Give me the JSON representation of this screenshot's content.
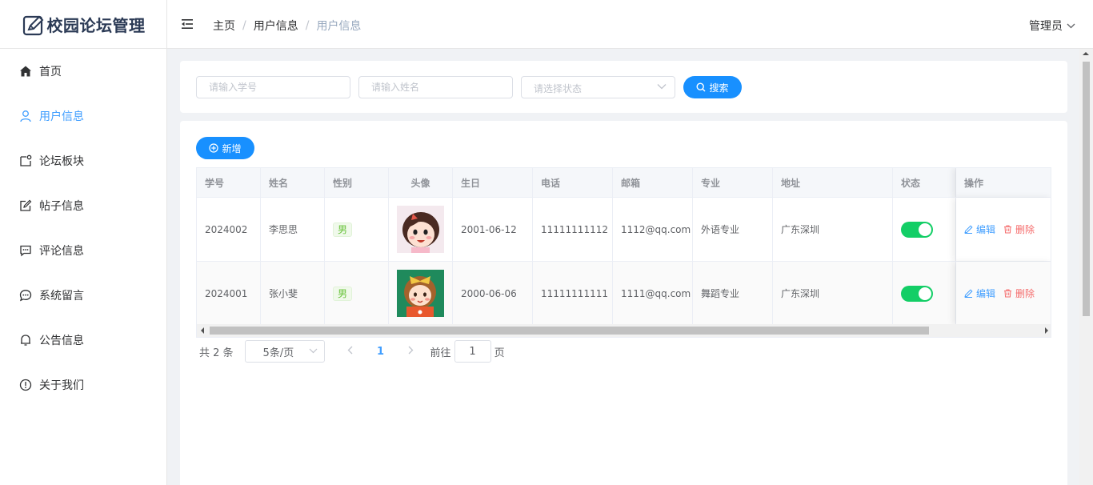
{
  "app": {
    "title": "校园论坛管理"
  },
  "breadcrumb": [
    "主页",
    "用户信息",
    "用户信息"
  ],
  "user_menu": {
    "label": "管理员"
  },
  "sidebar": {
    "items": [
      {
        "label": "首页",
        "icon": "home-icon",
        "active": false
      },
      {
        "label": "用户信息",
        "icon": "user-icon",
        "active": true
      },
      {
        "label": "论坛板块",
        "icon": "board-icon",
        "active": false
      },
      {
        "label": "帖子信息",
        "icon": "edit-icon",
        "active": false
      },
      {
        "label": "评论信息",
        "icon": "comment-icon",
        "active": false
      },
      {
        "label": "系统留言",
        "icon": "chat-icon",
        "active": false
      },
      {
        "label": "公告信息",
        "icon": "bell-icon",
        "active": false
      },
      {
        "label": "关于我们",
        "icon": "info-icon",
        "active": false
      }
    ]
  },
  "search": {
    "id_placeholder": "请输入学号",
    "name_placeholder": "请输入姓名",
    "status_placeholder": "请选择状态",
    "search_label": "搜索"
  },
  "toolbar": {
    "add_label": "新增"
  },
  "table": {
    "headers": {
      "id": "学号",
      "name": "姓名",
      "gender": "性别",
      "avatar": "头像",
      "birth": "生日",
      "phone": "电话",
      "email": "邮箱",
      "major": "专业",
      "address": "地址",
      "status": "状态",
      "ops": "操作"
    },
    "rows": [
      {
        "id": "2024002",
        "name": "李思思",
        "gender": "男",
        "birth": "2001-06-12",
        "phone": "11111111112",
        "email": "1112@qq.com",
        "major": "外语专业",
        "address": "广东深圳",
        "status_on": true,
        "edit": "编辑",
        "delete": "删除"
      },
      {
        "id": "2024001",
        "name": "张小斐",
        "gender": "男",
        "birth": "2000-06-06",
        "phone": "11111111111",
        "email": "1111@qq.com",
        "major": "舞蹈专业",
        "address": "广东深圳",
        "status_on": true,
        "edit": "编辑",
        "delete": "删除"
      }
    ]
  },
  "pagination": {
    "total": "共 2 条",
    "page_size": "5条/页",
    "current_page": "1",
    "goto_label": "前往",
    "goto_value": "1",
    "goto_unit": "页"
  },
  "colors": {
    "primary": "#1890ff",
    "active_menu": "#409eff",
    "switch_on": "#13ce66",
    "tag_green": "#67c23a",
    "danger": "#f56c6c"
  }
}
